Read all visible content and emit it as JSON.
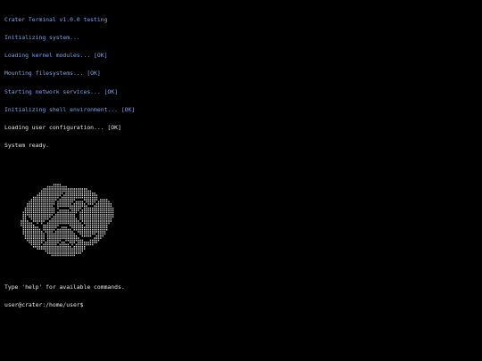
{
  "boot_log": [
    {
      "text": "Crater Terminal v1.0.0 testing",
      "color": "#7aa6ee"
    },
    {
      "text": "Initializing system...",
      "color": "#7aa6ee"
    },
    {
      "text": "Loading kernel modules... [OK]",
      "color": "#7aa6ee"
    },
    {
      "text": "Mounting filesystems... [OK]",
      "color": "#7aa6ee"
    },
    {
      "text": "Starting network services... [OK]",
      "color": "#7aa6ee"
    },
    {
      "text": "Initializing shell environment... [OK]",
      "color": "#7aa6ee"
    },
    {
      "text": "Loading user configuration... [OK]",
      "color": "#e8e8e8"
    },
    {
      "text": "System ready.",
      "color": "#e8e8e8"
    }
  ],
  "logo": {
    "icon": "brain-ascii-art-icon",
    "color": "#d8d8d8"
  },
  "help_text": "Type 'help' for available commands.",
  "prompt": "user@crater:/home/user$",
  "colors": {
    "background": "#000000",
    "accent": "#7aa6ee",
    "text": "#e8e8e8"
  }
}
